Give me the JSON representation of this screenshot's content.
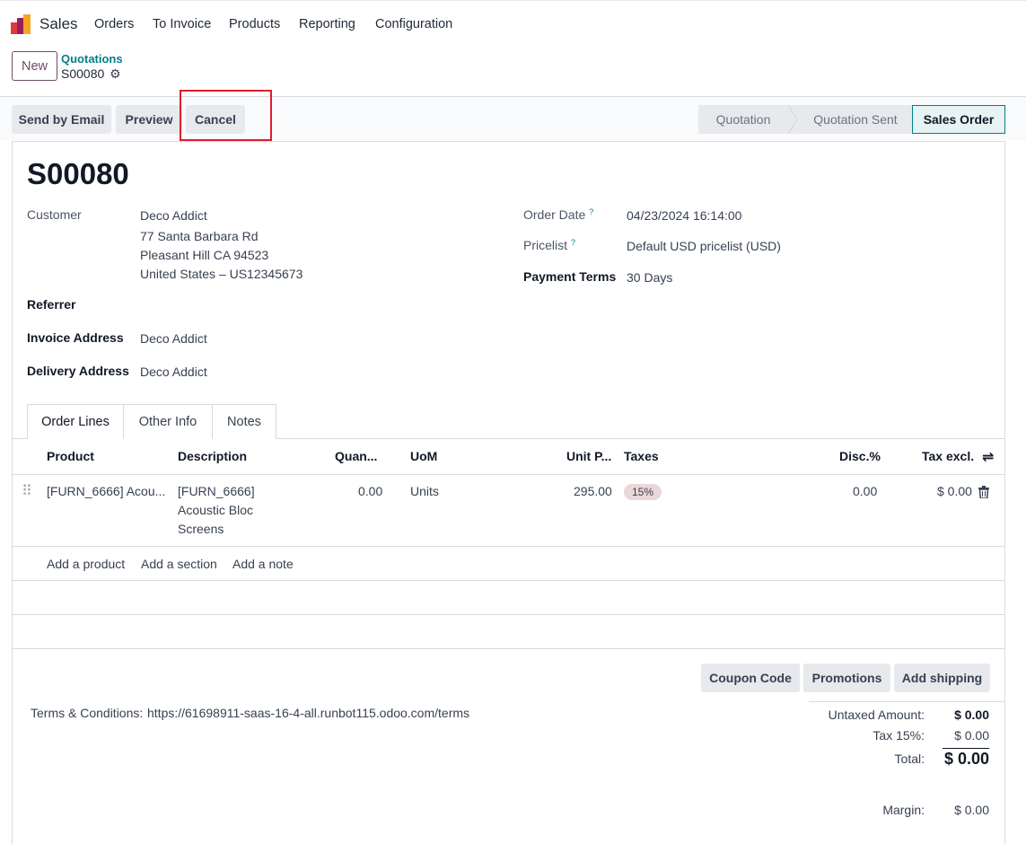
{
  "nav": {
    "app_name": "Sales",
    "menu": [
      "Orders",
      "To Invoice",
      "Products",
      "Reporting",
      "Configuration"
    ]
  },
  "control_panel": {
    "new_label": "New",
    "breadcrumb_parent": "Quotations",
    "breadcrumb_current": "S00080",
    "gear_icon": "gear-icon"
  },
  "actions": {
    "send_email": "Send by Email",
    "preview": "Preview",
    "cancel": "Cancel"
  },
  "statusbar": {
    "stages": [
      "Quotation",
      "Quotation Sent",
      "Sales Order"
    ],
    "active": "Sales Order"
  },
  "record": {
    "title": "S00080",
    "customer_label": "Customer",
    "customer_name": "Deco Addict",
    "address_line1": "77 Santa Barbara Rd",
    "address_line2": "Pleasant Hill CA 94523",
    "address_line3": "United States – US12345673",
    "referrer_label": "Referrer",
    "invoice_address_label": "Invoice Address",
    "invoice_address": "Deco Addict",
    "delivery_address_label": "Delivery Address",
    "delivery_address": "Deco Addict",
    "order_date_label": "Order Date",
    "order_date": "04/23/2024 16:14:00",
    "pricelist_label": "Pricelist",
    "pricelist": "Default USD pricelist (USD)",
    "payment_terms_label": "Payment Terms",
    "payment_terms": "30 Days",
    "help_marker": "?"
  },
  "tabs": [
    "Order Lines",
    "Other Info",
    "Notes"
  ],
  "order_lines": {
    "columns": [
      "Product",
      "Description",
      "Quan...",
      "UoM",
      "Unit P...",
      "Taxes",
      "Disc.%",
      "Tax excl."
    ],
    "rows": [
      {
        "product": "[FURN_6666] Acou...",
        "description_1": "[FURN_6666]",
        "description_2": "Acoustic Bloc",
        "description_3": "Screens",
        "quantity": "0.00",
        "uom": "Units",
        "unit_price": "295.00",
        "tax": "15%",
        "discount": "0.00",
        "subtotal": "$ 0.00"
      }
    ],
    "add_product": "Add a product",
    "add_section": "Add a section",
    "add_note": "Add a note"
  },
  "footer": {
    "coupon": "Coupon Code",
    "promotions": "Promotions",
    "shipping": "Add shipping",
    "terms_label": "Terms & Conditions:",
    "terms_url": "https://61698911-saas-16-4-all.runbot115.odoo.com/terms",
    "untaxed_label": "Untaxed Amount:",
    "untaxed_value": "$ 0.00",
    "tax_label": "Tax 15%:",
    "tax_value": "$ 0.00",
    "total_label": "Total:",
    "total_value": "$ 0.00",
    "margin_label": "Margin:",
    "margin_value": "$ 0.00"
  },
  "colors": {
    "brand": "#714b67",
    "link": "#017e84",
    "highlight_box": "#e11d2a"
  }
}
